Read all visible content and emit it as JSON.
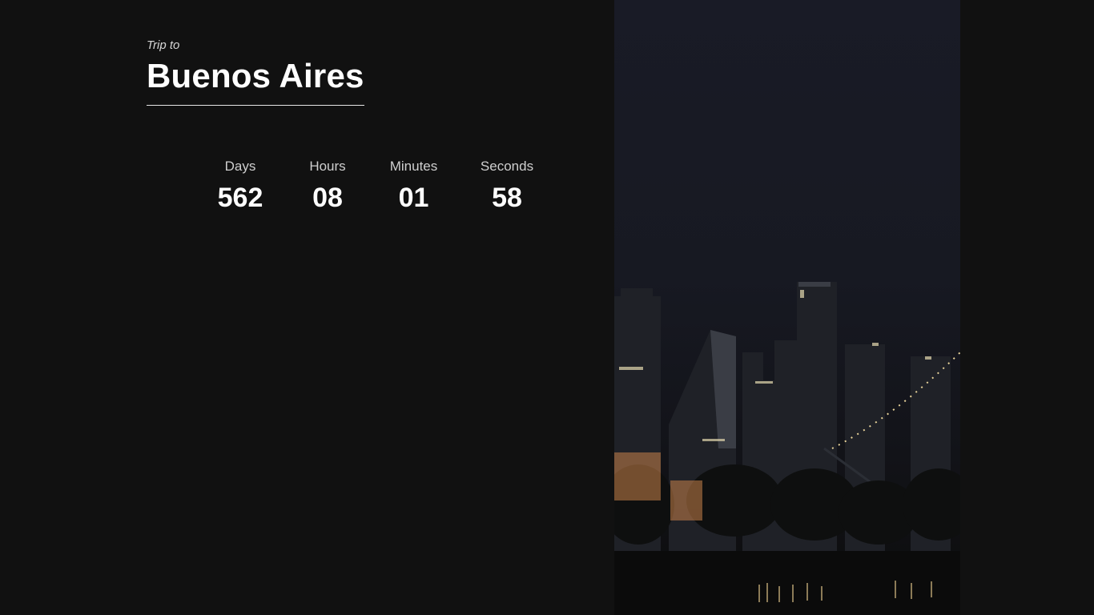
{
  "header": {
    "subtitle": "Trip to",
    "title": "Buenos Aires"
  },
  "countdown": {
    "days_label": "Days",
    "days_value": "562",
    "hours_label": "Hours",
    "hours_value": "08",
    "minutes_label": "Minutes",
    "minutes_value": "01",
    "seconds_label": "Seconds",
    "seconds_value": "58"
  },
  "colors": {
    "background": "#111111",
    "text": "#ffffff",
    "muted_text": "#cfcfcf"
  }
}
